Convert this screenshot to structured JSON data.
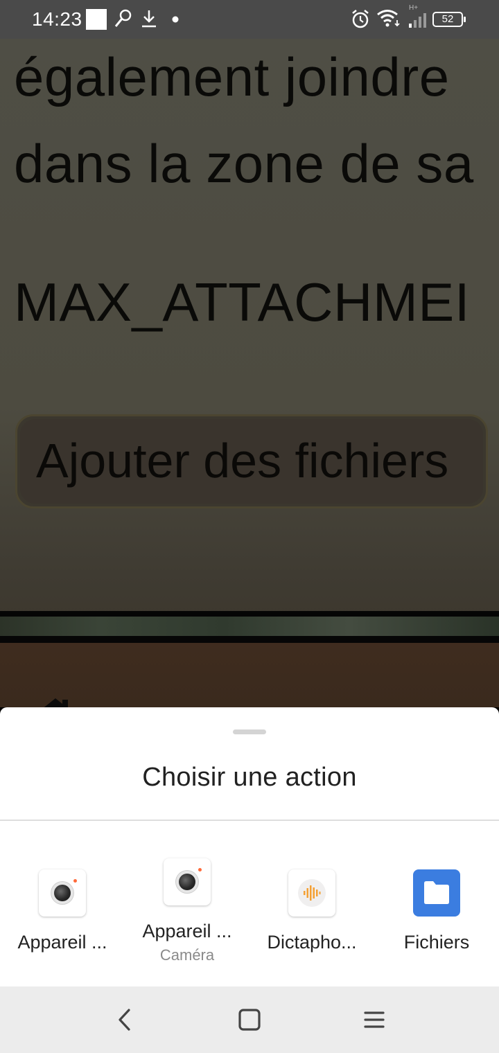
{
  "status_bar": {
    "time": "14:23",
    "battery": "52",
    "network_label": "H+",
    "icons": [
      "white-square-icon",
      "search-icon",
      "download-icon",
      "dot-icon",
      "alarm-icon",
      "wifi-icon",
      "signal-icon",
      "battery-icon"
    ]
  },
  "page": {
    "line1": "également joindre",
    "line2": "dans la zone de sa",
    "line3": "MAX_ATTACHMEI",
    "add_button": "Ajouter des fichiers"
  },
  "sheet": {
    "title": "Choisir une action",
    "apps": [
      {
        "label": "Appareil ...",
        "sublabel": "",
        "icon": "camera-icon"
      },
      {
        "label": "Appareil ...",
        "sublabel": "Caméra",
        "icon": "camera-icon"
      },
      {
        "label": "Dictapho...",
        "sublabel": "",
        "icon": "voice-recorder-icon"
      },
      {
        "label": "Fichiers",
        "sublabel": "",
        "icon": "folder-icon"
      }
    ]
  },
  "nav": {
    "icons": [
      "back-icon",
      "home-icon",
      "menu-icon"
    ]
  },
  "colors": {
    "status_bar": "#4a4a4a",
    "sheet_bg": "#ffffff",
    "nav_bg": "#ececec",
    "files_blue": "#3b7de0",
    "recorder_orange": "#f5a033"
  }
}
